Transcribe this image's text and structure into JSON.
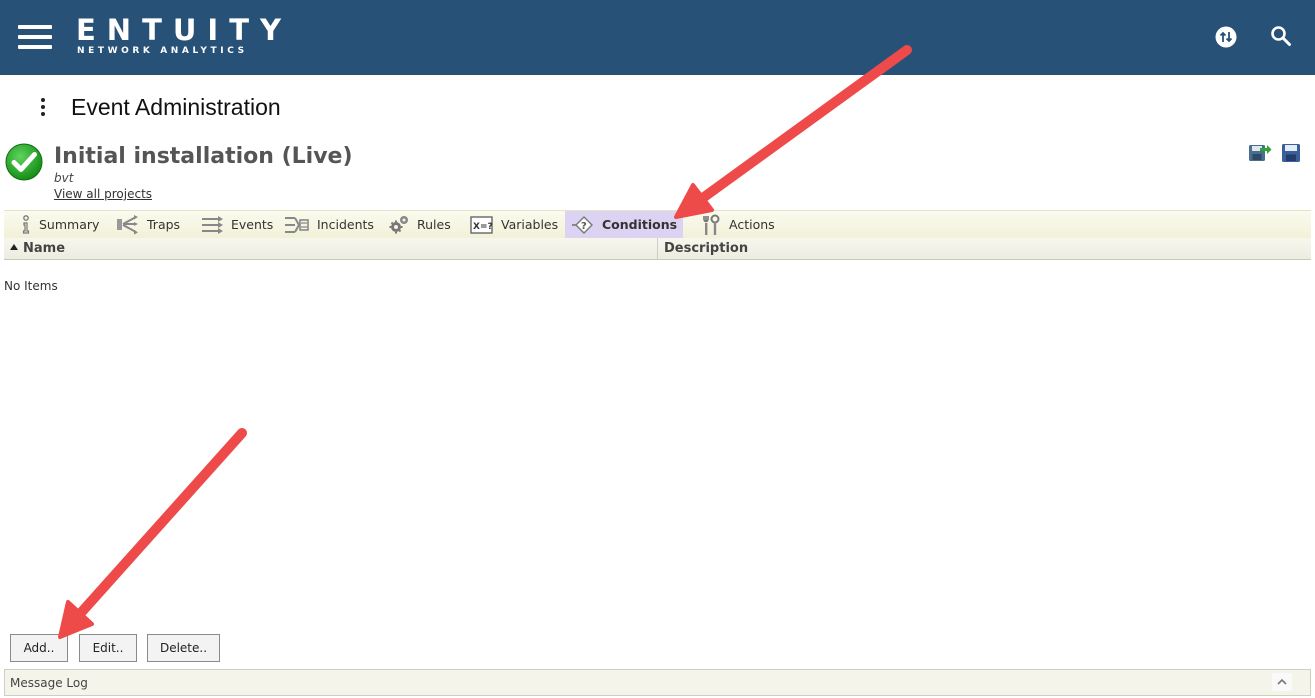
{
  "header": {
    "brand_name": "ENTUITY",
    "brand_sub": "NETWORK ANALYTICS",
    "icons": [
      "hamburger-menu-icon",
      "sync-icon",
      "search-icon"
    ],
    "background": "#285178"
  },
  "page": {
    "title": "Event Administration"
  },
  "project": {
    "name": "Initial installation (Live)",
    "subtitle": "bvt",
    "link": "View all projects",
    "status_color": "#1a9e1a"
  },
  "tabs": [
    {
      "label": "Summary",
      "icon": "summary-icon"
    },
    {
      "label": "Traps",
      "icon": "traps-icon"
    },
    {
      "label": "Events",
      "icon": "events-icon"
    },
    {
      "label": "Incidents",
      "icon": "incidents-icon"
    },
    {
      "label": "Rules",
      "icon": "rules-icon"
    },
    {
      "label": "Variables",
      "icon": "variables-icon"
    },
    {
      "label": "Conditions",
      "icon": "conditions-icon",
      "active": true
    },
    {
      "label": "Actions",
      "icon": "actions-icon"
    }
  ],
  "table": {
    "columns": [
      "Name",
      "Description"
    ],
    "empty_text": "No Items"
  },
  "buttons": {
    "add": "Add..",
    "edit": "Edit..",
    "delete": "Delete.."
  },
  "message_log": {
    "label": "Message Log"
  },
  "colors": {
    "active_tab": "#dcd2f2",
    "annotation_arrow": "#ef4a4a"
  }
}
